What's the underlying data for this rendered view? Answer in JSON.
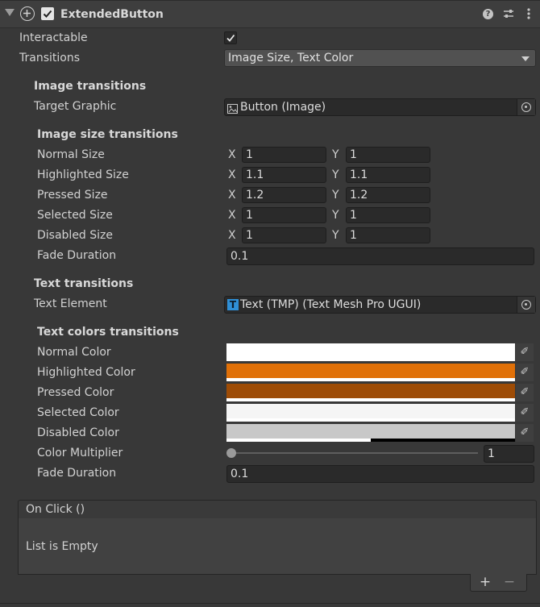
{
  "component": {
    "title": "ExtendedButton"
  },
  "props": {
    "interactable": {
      "label": "Interactable",
      "checked": true
    },
    "transitions": {
      "label": "Transitions",
      "value": "Image Size, Text Color"
    }
  },
  "image_transitions": {
    "header": "Image transitions",
    "target_graphic": {
      "label": "Target Graphic",
      "value": "Button (Image)"
    },
    "size_header": "Image size transitions",
    "sizes": [
      {
        "label": "Normal Size",
        "x": "1",
        "y": "1"
      },
      {
        "label": "Highlighted Size",
        "x": "1.1",
        "y": "1.1"
      },
      {
        "label": "Pressed Size",
        "x": "1.2",
        "y": "1.2"
      },
      {
        "label": "Selected Size",
        "x": "1",
        "y": "1"
      },
      {
        "label": "Disabled Size",
        "x": "1",
        "y": "1"
      }
    ],
    "fade": {
      "label": "Fade Duration",
      "value": "0.1"
    },
    "x_label": "X",
    "y_label": "Y"
  },
  "text_transitions": {
    "header": "Text transitions",
    "text_element": {
      "label": "Text Element",
      "value": "Text (TMP) (Text Mesh Pro UGUI)"
    },
    "colors_header": "Text colors transitions",
    "colors": [
      {
        "label": "Normal Color",
        "color": "#ffffff",
        "alpha": 1.0
      },
      {
        "label": "Highlighted Color",
        "color": "#e07008",
        "alpha": 1.0
      },
      {
        "label": "Pressed Color",
        "color": "#9e4c06",
        "alpha": 1.0
      },
      {
        "label": "Selected Color",
        "color": "#f5f5f5",
        "alpha": 1.0
      },
      {
        "label": "Disabled Color",
        "color": "#c8c8c8",
        "alpha": 0.5
      }
    ],
    "multiplier": {
      "label": "Color Multiplier",
      "value": "1",
      "slider_fraction": 0.0
    },
    "fade": {
      "label": "Fade Duration",
      "value": "0.1"
    }
  },
  "on_click": {
    "title": "On Click ()",
    "empty_text": "List is Empty",
    "add_symbol": "+",
    "remove_symbol": "−"
  },
  "colors": {
    "background": "#383838",
    "header_bg": "#3e3e3e",
    "field_bg": "#2a2a2a"
  }
}
